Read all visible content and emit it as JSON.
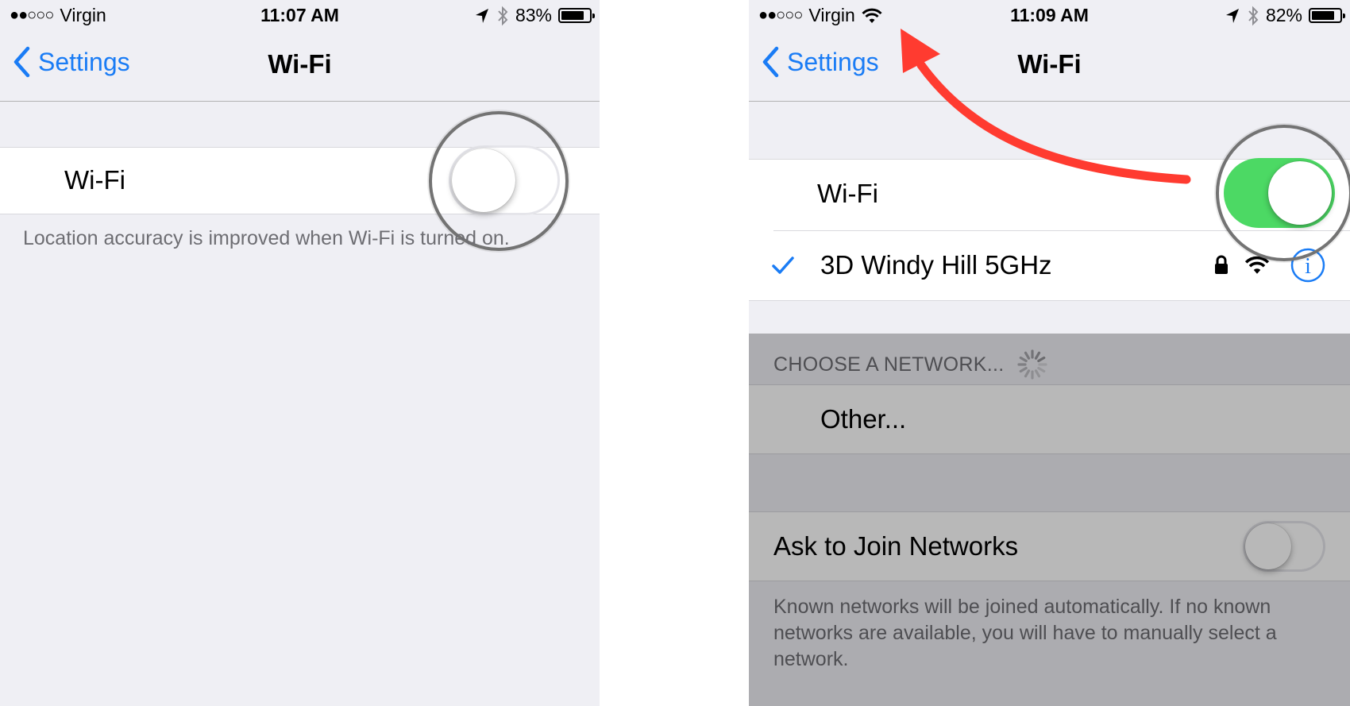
{
  "left": {
    "status": {
      "signal": "●●○○○",
      "carrier": "Virgin",
      "time": "11:07 AM",
      "battery": "83%",
      "battery_level": 0.83
    },
    "nav": {
      "back_label": "Settings",
      "title": "Wi-Fi"
    },
    "wifi_row": {
      "label": "Wi-Fi",
      "switch_on": false
    },
    "footer": "Location accuracy is improved when Wi-Fi is turned on."
  },
  "right": {
    "status": {
      "signal": "●●○○○",
      "carrier": "Virgin",
      "time": "11:09 AM",
      "battery": "82%",
      "battery_level": 0.82
    },
    "nav": {
      "back_label": "Settings",
      "title": "Wi-Fi"
    },
    "wifi_row": {
      "label": "Wi-Fi",
      "switch_on": true
    },
    "connected_network": {
      "name": "3D Windy Hill 5GHz",
      "locked": true
    },
    "choose_header": "CHOOSE A NETWORK...",
    "other_label": "Other...",
    "ask_to_join": {
      "label": "Ask to Join Networks",
      "switch_on": false
    },
    "ask_footer": "Known networks will be joined automatically. If no known networks are available, you will have to manually select a network."
  },
  "icons": [
    "location-arrow-icon",
    "bluetooth-icon",
    "battery-icon",
    "wifi-icon",
    "chevron-left-icon",
    "checkmark-icon",
    "lock-icon",
    "info-icon",
    "spinner-icon",
    "red-arrow"
  ],
  "colors": {
    "accent": "#1a7cf5",
    "switch_on": "#4cd964",
    "arrow": "#ff3b30",
    "background": "#efeff4"
  }
}
